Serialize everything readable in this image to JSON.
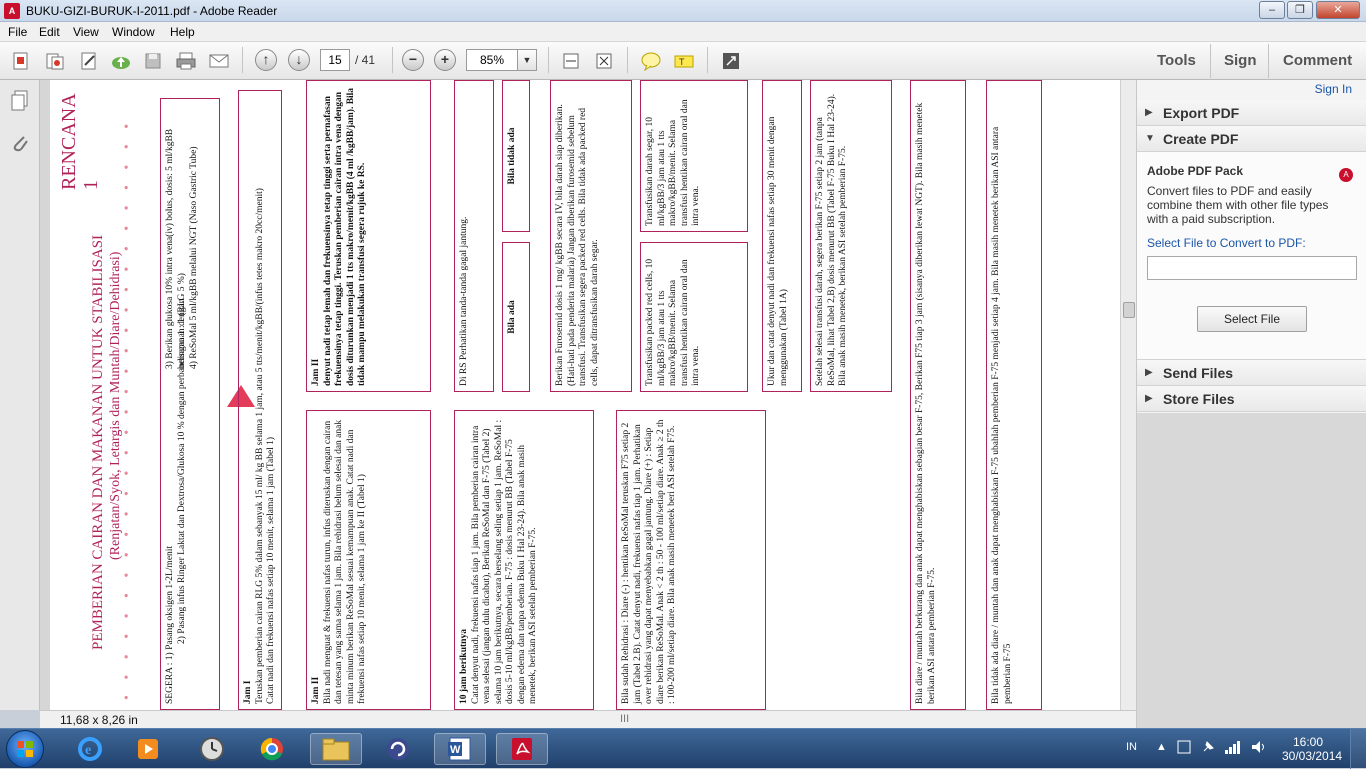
{
  "window": {
    "title": "BUKU-GIZI-BURUK-I-2011.pdf - Adobe Reader",
    "min": "–",
    "max": "❐",
    "close": "✕"
  },
  "menu": [
    "File",
    "Edit",
    "View",
    "Window",
    "Help"
  ],
  "toolbar": {
    "page_current": "15",
    "page_total": "/ 41",
    "zoom": "85%",
    "tools": "Tools",
    "sign": "Sign",
    "comment": "Comment"
  },
  "statusbar": {
    "dimensions": "11,68 x 8,26 in",
    "grip": "III"
  },
  "right_panel": {
    "sign_in": "Sign In",
    "export_pdf": "Export PDF",
    "create_pdf": "Create PDF",
    "pack_title": "Adobe PDF Pack",
    "pack_desc": "Convert files to PDF and easily combine them with other file types with a paid subscription.",
    "select_label": "Select File to Convert to PDF:",
    "select_button": "Select File",
    "send_files": "Send Files",
    "store_files": "Store Files"
  },
  "document": {
    "rencana": "RENCANA 1",
    "heading": "PEMBERIAN CAIRAN DAN MAKANAN UNTUK STABILISASI",
    "subheading": "(Renjatan/Syok, Letargis dan Muntah/Diare/Dehidrasi)",
    "segera": "SEGERA : 1) Pasang oksigen 1-2L/menit",
    "segera2": "2) Pasang infus Ringer Laktat dan Dextrosa/Glukosa 10 % dengan perbandingan 1 : 1 (RLG 5 %)",
    "segera3": "3) Berikan glukosa 10% intra vena(iv) bolus, dosis: 5 ml/kgBB bersamaan dengan",
    "segera4": "4) ReSoMal 5 ml/kgBB melalui NGT (Naso Gastric Tube)",
    "jam1_title": "Jam I",
    "jam1_a": "Teruskan pemberian cairan RLG 5% dalam sebanyak 15 ml/ kg BB selama 1 jam, atau 5 tts/menit/kgBB/(infus tetes makro 20cc/menit)",
    "jam1_b": "Catat nadi dan frekuensi nafas setiap 10 menit, selama 1 jam (Tabel 1)",
    "jam2a_title": "Jam II",
    "jam2a_text": "denyut nadi tetap lemah dan frekuensinya tetap tinggi serta pernafasan frekuensinya tetap tinggi. Teruskan pemberian cairan intra vena dengan dosis diturunkan menjadi 1 tts makro/menit/kgBB (4 ml /kgBB/jam). Bila tidak mampu melakukan transfusi segera rujuk ke RS.",
    "jam2b_title": "Jam II",
    "jam2b_text": "Bila nadi menguat & frekuensi nafas turun, infus diteruskan dengan cairan dan tetesan yang sama selama 1 jam. Bila rehidrasi belum selesai dan anak minta minum berikan ReSoMal sesuai kemampuan anak. Catat nadi dan frekuensi nafas setiap 10 menit, selama 1 jam ke II (Tabel 1)",
    "rs_text": "Di RS Perhatikan tanda-tanda gagal jantung.",
    "bila_ada": "Bila ada",
    "bila_tidak_ada": "Bila tidak ada",
    "furosemid": "Berikan Furosemid dosis 1 mg/ kgBB secara IV, bila darah siap diberikan. (Hati-hati pada penderita malaria) Jangan diberikan furosemid sebelum transfusi. Transfusikan segera packed red cells. Bila tidak ada packed red cells, dapat ditransfusikan darah segar.",
    "packed": "Transfusikan packed red cells, 10 ml/kgBB/3 jam atau 1 tts makro/kgBB/menit. Selama transfusi hentikan cairan oral dan intra vena.",
    "darah_segar": "Transfusikan darah segar, 10 ml/kgBB/3 jam atau 1 tts makro/kgBB/menit. Selama transfusi hentikan cairan oral dan intra vena.",
    "ukur": "Ukur dan catat denyut nadi dan frekuensi nafas setiap 30 menit dengan menggunakan (Tabel 1A)",
    "setelah": "Setelah selesai transfusi darah, segera berikan F-75 setiap 2 jam (tanpa ReSoMal, lihat Tabel 2,B) dosis menurut BB (Tabel F-75 Buku I Hal 23-24). Bila anak masih menetek, berikan ASI setelah pemberian F-75.",
    "jam10_title": "10 jam berikutnya",
    "jam10_text": "Catat denyut nadi, frekuensi nafas tiap 1 jam. Bila pemberian cairan intra vena selesai (jangan dulu dicabut), Berikan ReSoMal dan F-75 (Tabel 2) selama 10 jam berikutnya, secara berselang seling setiap 1 jam. ReSoMal : dosis 5-10 ml/kgBB/pemberian. F-75 : dosis menurut BB (Tabel F-75 dengan edema dan tanpa edema Buku I Hal 23-24). Bila anak masih menetek, berikan ASI setelah pemberian F-75.",
    "rehidrasi": "Bila sudah Rehidrasi : Diare (-) : hentikan ReSoMal teruskan F75 setiap 2 jam (Tabel 2.B). Catat denyut nadi, frekuensi nafas tiap 1 jam. Perhatikan over rehidrasi yang dapat menyebabkan gagal jantung. Diare (+) : Setiap diare berikan ReSoMal. Anak < 2 th : 50 - 100 ml/setiap diare. Anak ≥ 2 th : 100-200 ml/setiap diare. Bila anak masih menetek beri ASI setelah F75.",
    "diare_stop": "Bila diare / muntah berkurang dan anak dapat menghabiskan sebagian besar F-75, Berikan F75 tiap 3 jam (sisanya diberikan lewat NGT). Bila masih menetek berikan ASI antara pemberian F-75.",
    "diare_not": "Bila tidak ada diare / muntah dan anak dapat menghabiskan F-75 ubahlah pemberian F-75 menjadi setiap 4 jam. Bila masih menetek berikan ASI antara pemberian F-75"
  },
  "taskbar": {
    "lang": "IN",
    "time": "16:00",
    "date": "30/03/2014"
  },
  "colors": {
    "accent_border": "#b0235a",
    "arrow": "#e8556b"
  }
}
